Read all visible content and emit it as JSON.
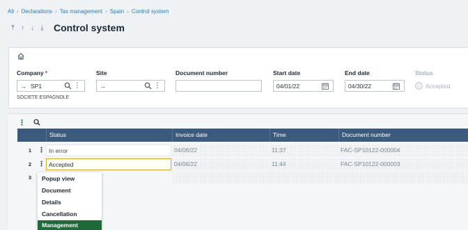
{
  "breadcrumb": [
    "All",
    "Declarations",
    "Tax management",
    "Spain",
    "Control system"
  ],
  "title": "Control system",
  "criteria": {
    "company": {
      "label": "Company",
      "required_mark": "*",
      "value": "SP1",
      "description": "SOCIETE ESPAGNOLE"
    },
    "site": {
      "label": "Site",
      "value": ""
    },
    "document_number": {
      "label": "Document number",
      "value": ""
    },
    "start_date": {
      "label": "Start date",
      "value": "04/01/22"
    },
    "end_date": {
      "label": "End date",
      "value": "04/30/22"
    },
    "status": {
      "label": "Status",
      "option": "Accepted"
    }
  },
  "grid": {
    "columns": [
      "Status",
      "Invoice date",
      "Time",
      "Document number"
    ],
    "rows": [
      {
        "num": "1",
        "status": "In error",
        "invoice_date": "04/06/22",
        "time": "11:37",
        "document_number": "FAC-SP10122-000004"
      },
      {
        "num": "2",
        "status": "Accepted",
        "invoice_date": "04/06/22",
        "time": "11:44",
        "document_number": "FAC-SP10122-000003"
      },
      {
        "num": "3",
        "status": "",
        "invoice_date": "",
        "time": "",
        "document_number": ""
      }
    ]
  },
  "context_menu": {
    "items": [
      "Popup view",
      "Document",
      "Details",
      "Cancellation",
      "Management"
    ],
    "highlighted": "Management"
  },
  "colors": {
    "link": "#2a7ab0",
    "grid_header": "#3c5a7b",
    "menu_highlight": "#1d6a3a",
    "required": "#d33a3a",
    "active_cell_border": "#d4a72c"
  }
}
